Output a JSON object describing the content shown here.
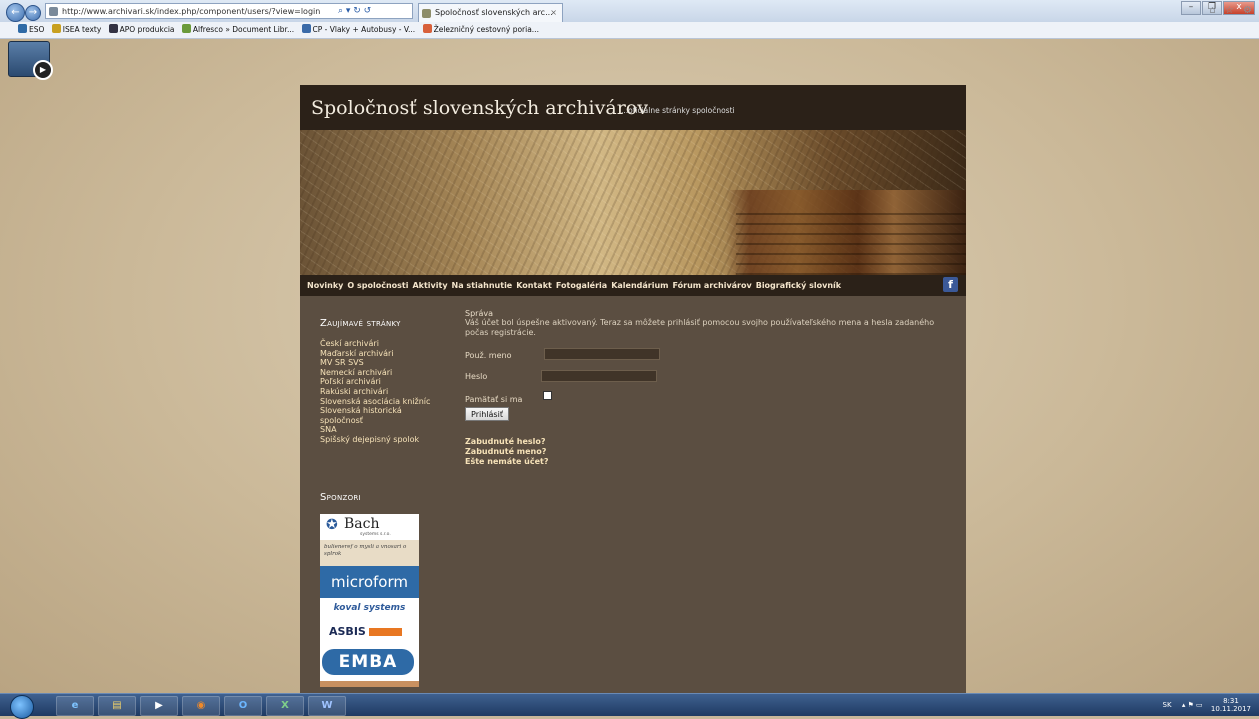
{
  "browser": {
    "address": "http://www.archivari.sk/index.php/component/users/?view=login",
    "tab_title": "Spoločnosť slovenských arc...",
    "tab_close": "×",
    "nav_back": "←",
    "nav_forward": "→",
    "search_glyph": "⌕ ▾ ↻ ↺",
    "window_buttons": [
      "–",
      "❐",
      "x"
    ],
    "right_icons": "⌂ ☆ ⚙",
    "favorites": [
      "ESO",
      "ISEA texty",
      "APO produkcia",
      "Alfresco » Document Libr...",
      "CP - Vlaky + Autobusy - V...",
      "Železničný cestovný poria..."
    ]
  },
  "site": {
    "title": "Spoločnosť slovenských archivárov",
    "tagline": "...oficiálne stránky spoločnosti",
    "menu": [
      "Novinky",
      "O spoločnosti",
      "Aktivity",
      "Na stiahnutie",
      "Kontakt",
      "Fotogaléria",
      "Kalendárium",
      "Fórum archivárov",
      "Biografický slovník"
    ],
    "facebook": "f"
  },
  "sidebar": {
    "interesting_title": "Zaujímavé stránky",
    "links": [
      "Českí archivári",
      "Maďarskí archivári",
      "MV SR SVS",
      "Nemeckí archivári",
      "Poľskí archivári",
      "Rakúski archivári",
      "Slovenská asociácia knižníc",
      "Slovenská historická",
      "spoločnosť",
      "SNA",
      "Spišský dejepisný spolok"
    ],
    "sponsors_title": "Sponzori",
    "sponsors": {
      "bach": "Bach",
      "bach_sub": "systems s.r.o.",
      "bach_slogan": "bulieneref o mysli a vnosari o splrok",
      "microform": "microform",
      "koval": "koval systems",
      "asbis": "ASBIS",
      "emba": "EMBA"
    }
  },
  "login": {
    "message_title": "Správa",
    "message_body": "Váš účet bol úspešne aktivovaný. Teraz sa môžete prihlásiť pomocou svojho používateľského mena a hesla zadaného počas registrácie.",
    "username_label": "Použ. meno",
    "password_label": "Heslo",
    "remember_label": "Pamätať si ma",
    "submit_label": "Prihlásiť",
    "forgot_password": "Zabudnuté heslo?",
    "forgot_username": "Zabudnuté meno?",
    "no_account": "Ešte nemáte účet?"
  },
  "taskbar": {
    "apps": [
      "e",
      "▤",
      "▶",
      "◉",
      "O",
      "X",
      "W"
    ],
    "language": "SK",
    "tray_icons": "▴ ⚑ ▭",
    "time": "8:31",
    "date": "10.11.2017"
  }
}
